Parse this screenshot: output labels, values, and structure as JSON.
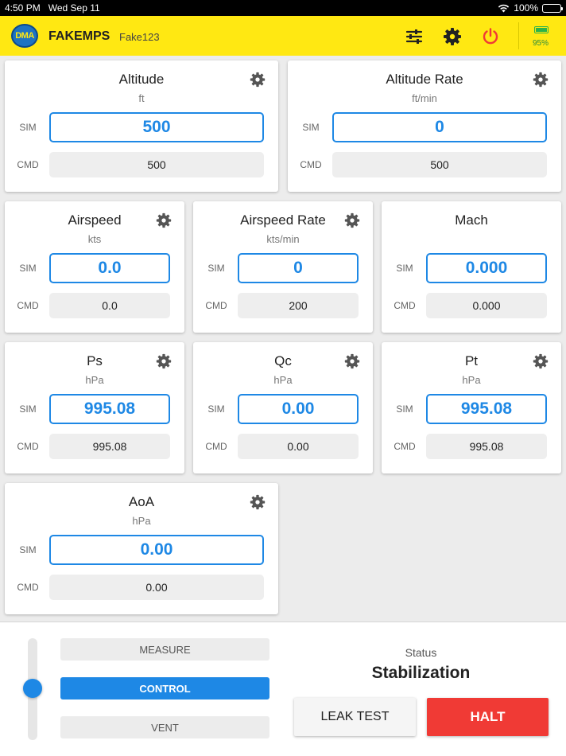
{
  "status_bar": {
    "time": "4:50 PM",
    "date": "Wed Sep 11",
    "battery": "100%",
    "icons": [
      "wifi-icon",
      "battery-icon"
    ]
  },
  "header": {
    "logo_text": "DMA",
    "app_name": "FAKEMPS",
    "device_name": "Fake123",
    "battery_percent": "95%",
    "icons": [
      "sliders-icon",
      "gear-icon",
      "power-icon",
      "battery-icon"
    ],
    "colors": {
      "background": "#ffe812",
      "power": "#f03a35",
      "battery": "#2cb34a"
    }
  },
  "labels": {
    "sim": "SIM",
    "cmd": "CMD"
  },
  "cards": {
    "altitude": {
      "title": "Altitude",
      "unit": "ft",
      "sim": "500",
      "cmd": "500"
    },
    "altitude_rate": {
      "title": "Altitude Rate",
      "unit": "ft/min",
      "sim": "0",
      "cmd": "500"
    },
    "airspeed": {
      "title": "Airspeed",
      "unit": "kts",
      "sim": "0.0",
      "cmd": "0.0"
    },
    "airspeed_rate": {
      "title": "Airspeed Rate",
      "unit": "kts/min",
      "sim": "0",
      "cmd": "200"
    },
    "mach": {
      "title": "Mach",
      "unit": "",
      "sim": "0.000",
      "cmd": "0.000"
    },
    "ps": {
      "title": "Ps",
      "unit": "hPa",
      "sim": "995.08",
      "cmd": "995.08"
    },
    "qc": {
      "title": "Qc",
      "unit": "hPa",
      "sim": "0.00",
      "cmd": "0.00"
    },
    "pt": {
      "title": "Pt",
      "unit": "hPa",
      "sim": "995.08",
      "cmd": "995.08"
    },
    "aoa": {
      "title": "AoA",
      "unit": "hPa",
      "sim": "0.00",
      "cmd": "0.00"
    }
  },
  "mode": {
    "options": [
      "MEASURE",
      "CONTROL",
      "VENT"
    ],
    "selected": "CONTROL"
  },
  "status": {
    "label": "Status",
    "value": "Stabilization"
  },
  "actions": {
    "leak_test": "LEAK TEST",
    "halt": "HALT"
  },
  "colors": {
    "accent": "#1e88e5",
    "halt": "#f03a35"
  }
}
